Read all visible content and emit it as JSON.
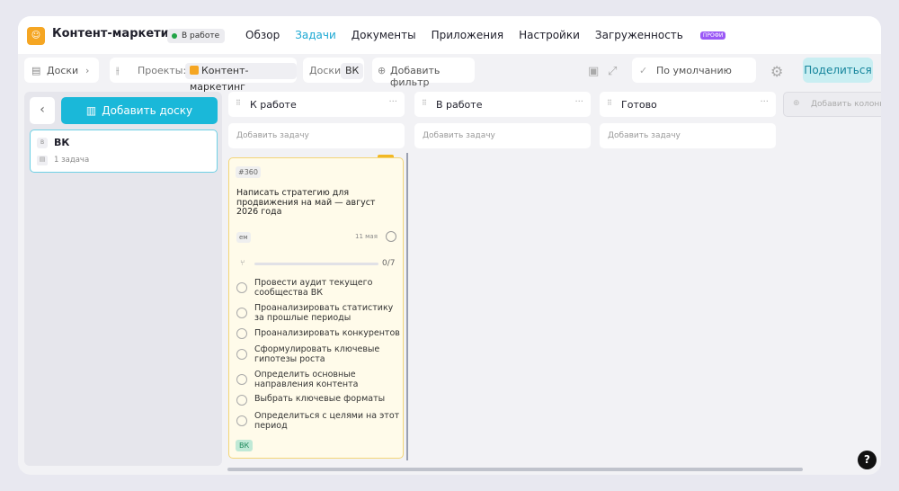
{
  "project": {
    "title": "Контент-маркетинг",
    "status": "В работе"
  },
  "nav": [
    "Обзор",
    "Задачи",
    "Документы",
    "Приложения",
    "Настройки",
    "Загруженность"
  ],
  "nav_badge": "ПРОФИ",
  "toolbar": {
    "boards_label": "Доски",
    "projects_label": "Проекты:",
    "project_chip": "Контент-маркетинг",
    "boards_filter_label": "Доски:",
    "board_chip": "ВК",
    "add_filter": "Добавить фильтр",
    "sort_label": "По умолчанию",
    "share": "Поделиться"
  },
  "sidebar": {
    "add_board": "Добавить доску",
    "boards": [
      {
        "name": "ВК",
        "count": "1 задача"
      }
    ]
  },
  "columns": [
    {
      "name": "К работе",
      "add_task": "Добавить задачу"
    },
    {
      "name": "В работе",
      "add_task": "Добавить задачу"
    },
    {
      "name": "Готово",
      "add_task": "Добавить задачу"
    }
  ],
  "add_column": "Добавить колонку",
  "card": {
    "number": "#360",
    "title": "Написать стратегию для продвижения на май — август 2026 года",
    "assignee": "ем",
    "date": "11 мая",
    "progress": "0/7",
    "subtasks": [
      "Провести аудит текущего сообщества ВК",
      "Проанализировать статистику за прошлые периоды",
      "Проанализировать конкурентов",
      "Сформулировать ключевые гипотезы роста",
      "Определить основные направления контента",
      "Выбрать ключевые форматы",
      "Определиться с целями на этот период"
    ],
    "tag": "ВК"
  },
  "help": "?"
}
